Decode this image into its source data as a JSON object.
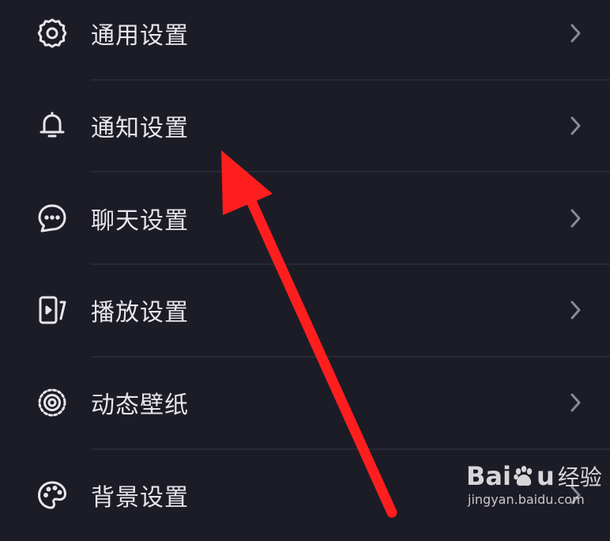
{
  "settings": {
    "items": [
      {
        "label": "通用设置",
        "icon": "gear-icon"
      },
      {
        "label": "通知设置",
        "icon": "bell-icon"
      },
      {
        "label": "聊天设置",
        "icon": "chat-bubble-icon"
      },
      {
        "label": "播放设置",
        "icon": "playback-icon"
      },
      {
        "label": "动态壁纸",
        "icon": "live-wallpaper-icon"
      },
      {
        "label": "背景设置",
        "icon": "palette-icon"
      }
    ]
  },
  "watermark": {
    "brand_left": "Bai",
    "brand_right": "u",
    "brand_cn": "经验",
    "domain": "jingyan.baidu.com"
  },
  "colors": {
    "background": "#1c1c27",
    "text": "#e6e6ea",
    "icon": "#e6e6ea",
    "chevron": "#8a8a94",
    "divider": "#2a2a36",
    "annotation_arrow": "#ff1e1e"
  }
}
